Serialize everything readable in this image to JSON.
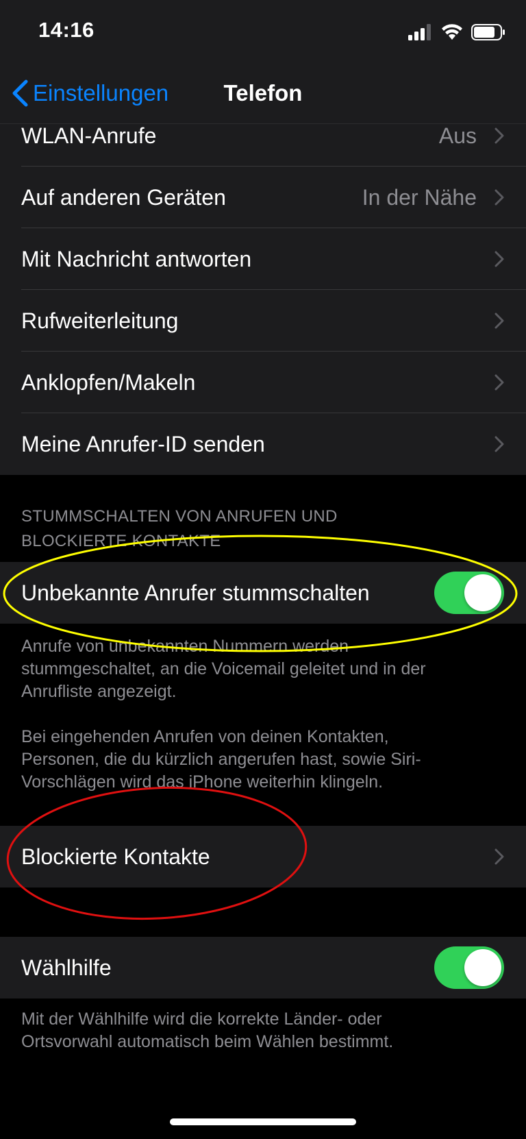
{
  "status_bar": {
    "time": "14:16",
    "signal_icon": "cellular-signal-icon",
    "wifi_icon": "wifi-icon",
    "battery_icon": "battery-icon"
  },
  "nav": {
    "back_label": "Einstellungen",
    "title": "Telefon"
  },
  "group1": {
    "rows": [
      {
        "label": "WLAN-Anrufe",
        "value": "Aus"
      },
      {
        "label": "Auf anderen Geräten",
        "value": "In der Nähe"
      },
      {
        "label": "Mit Nachricht antworten",
        "value": ""
      },
      {
        "label": "Rufweiterleitung",
        "value": ""
      },
      {
        "label": "Anklopfen/Makeln",
        "value": ""
      },
      {
        "label": "Meine Anrufer-ID senden",
        "value": ""
      }
    ]
  },
  "silence_section": {
    "header_line1": "STUMMSCHALTEN VON ANRUFEN UND",
    "header_line2": "BLOCKIERTE KONTAKTE",
    "toggle_label": "Unbekannte Anrufer stummschalten",
    "toggle_on": true,
    "footer_p1_line1": "Anrufe von unbekannten Nummern werden",
    "footer_p1_line2": "stummgeschaltet, an die Voicemail geleitet und in der",
    "footer_p1_line3": "Anrufliste angezeigt.",
    "footer_p2_line1": "Bei eingehenden Anrufen von deinen Kontakten,",
    "footer_p2_line2": "Personen, die du kürzlich angerufen hast, sowie Siri-",
    "footer_p2_line3": "Vorschlägen wird das iPhone weiterhin klingeln."
  },
  "blocked": {
    "label": "Blockierte Kontakte"
  },
  "dial_assist": {
    "label": "Wählhilfe",
    "toggle_on": true,
    "footer_line1": "Mit der Wählhilfe wird die korrekte Länder- oder",
    "footer_line2": "Ortsvorwahl automatisch beim Wählen bestimmt."
  },
  "colors": {
    "accent": "#0a84ff",
    "toggle_on": "#30d158",
    "annotation_yellow": "#ffff00",
    "annotation_red": "#e01010"
  }
}
